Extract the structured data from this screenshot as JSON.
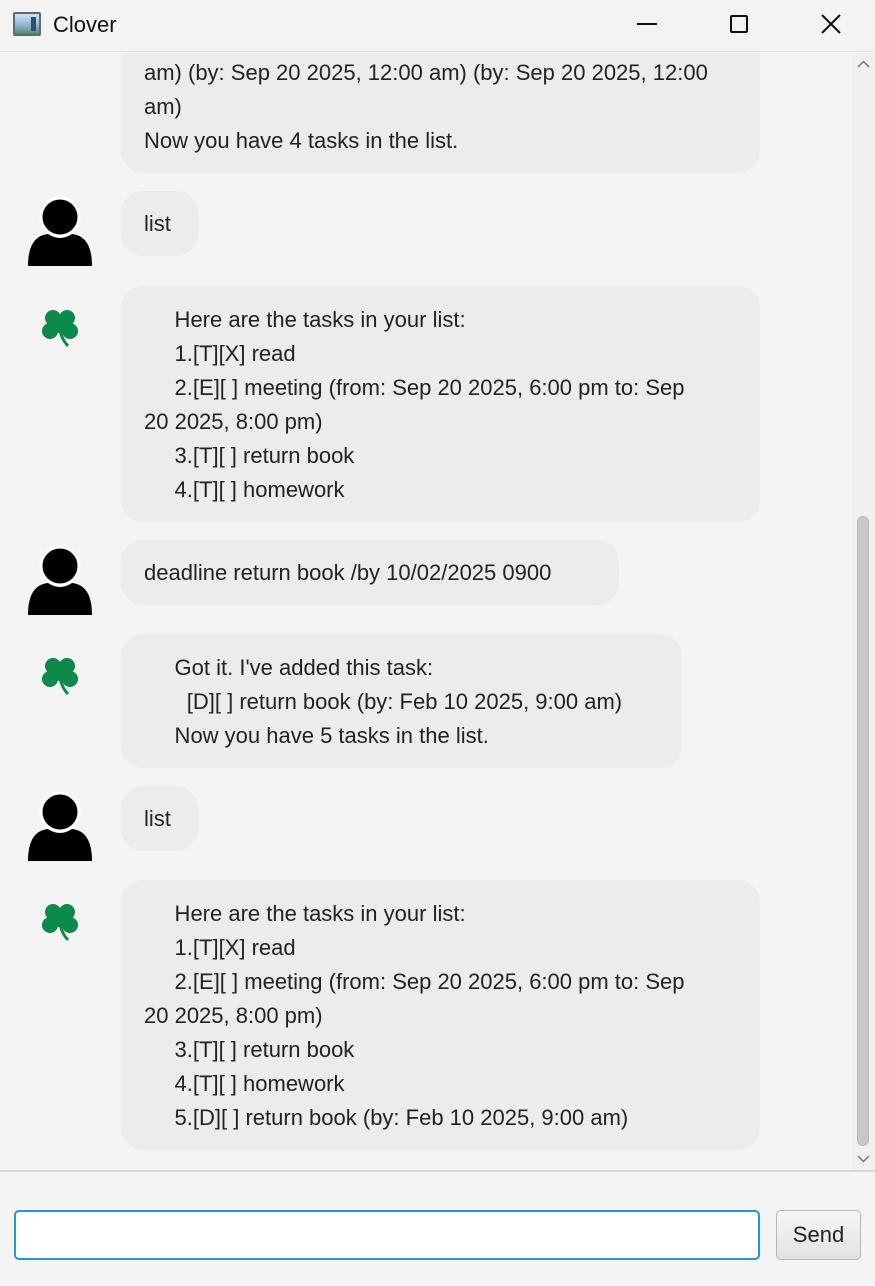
{
  "window": {
    "title": "Clover"
  },
  "messages": [
    {
      "sender": "bot",
      "lines": [
        "am) (by: Sep 20 2025, 12:00 am) (by: Sep 20 2025, 12:00",
        "am)",
        "Now you have 4 tasks in the list."
      ]
    },
    {
      "sender": "user",
      "lines": [
        "list"
      ]
    },
    {
      "sender": "bot",
      "lines": [
        "     Here are the tasks in your list:",
        "     1.[T][X] read",
        "     2.[E][ ] meeting (from: Sep 20 2025, 6:00 pm to: Sep",
        "20 2025, 8:00 pm)",
        "     3.[T][ ] return book",
        "     4.[T][ ] homework"
      ]
    },
    {
      "sender": "user",
      "lines": [
        "deadline return book /by 10/02/2025 0900"
      ]
    },
    {
      "sender": "bot",
      "lines": [
        "     Got it. I've added this task:",
        "       [D][ ] return book (by: Feb 10 2025, 9:00 am)",
        "     Now you have 5 tasks in the list."
      ]
    },
    {
      "sender": "user",
      "lines": [
        "list"
      ]
    },
    {
      "sender": "bot",
      "lines": [
        "     Here are the tasks in your list:",
        "     1.[T][X] read",
        "     2.[E][ ] meeting (from: Sep 20 2025, 6:00 pm to: Sep",
        "20 2025, 8:00 pm)",
        "     3.[T][ ] return book",
        "     4.[T][ ] homework",
        "     5.[D][ ] return book (by: Feb 10 2025, 9:00 am)"
      ]
    }
  ],
  "input": {
    "value": "",
    "placeholder": ""
  },
  "send_label": "Send",
  "icons": {
    "user": "user-silhouette-icon",
    "bot": "four-leaf-clover-icon"
  },
  "colors": {
    "bubble": "#ececec",
    "clover": "#0b8a4a",
    "input_focus": "#1a9ad8"
  }
}
